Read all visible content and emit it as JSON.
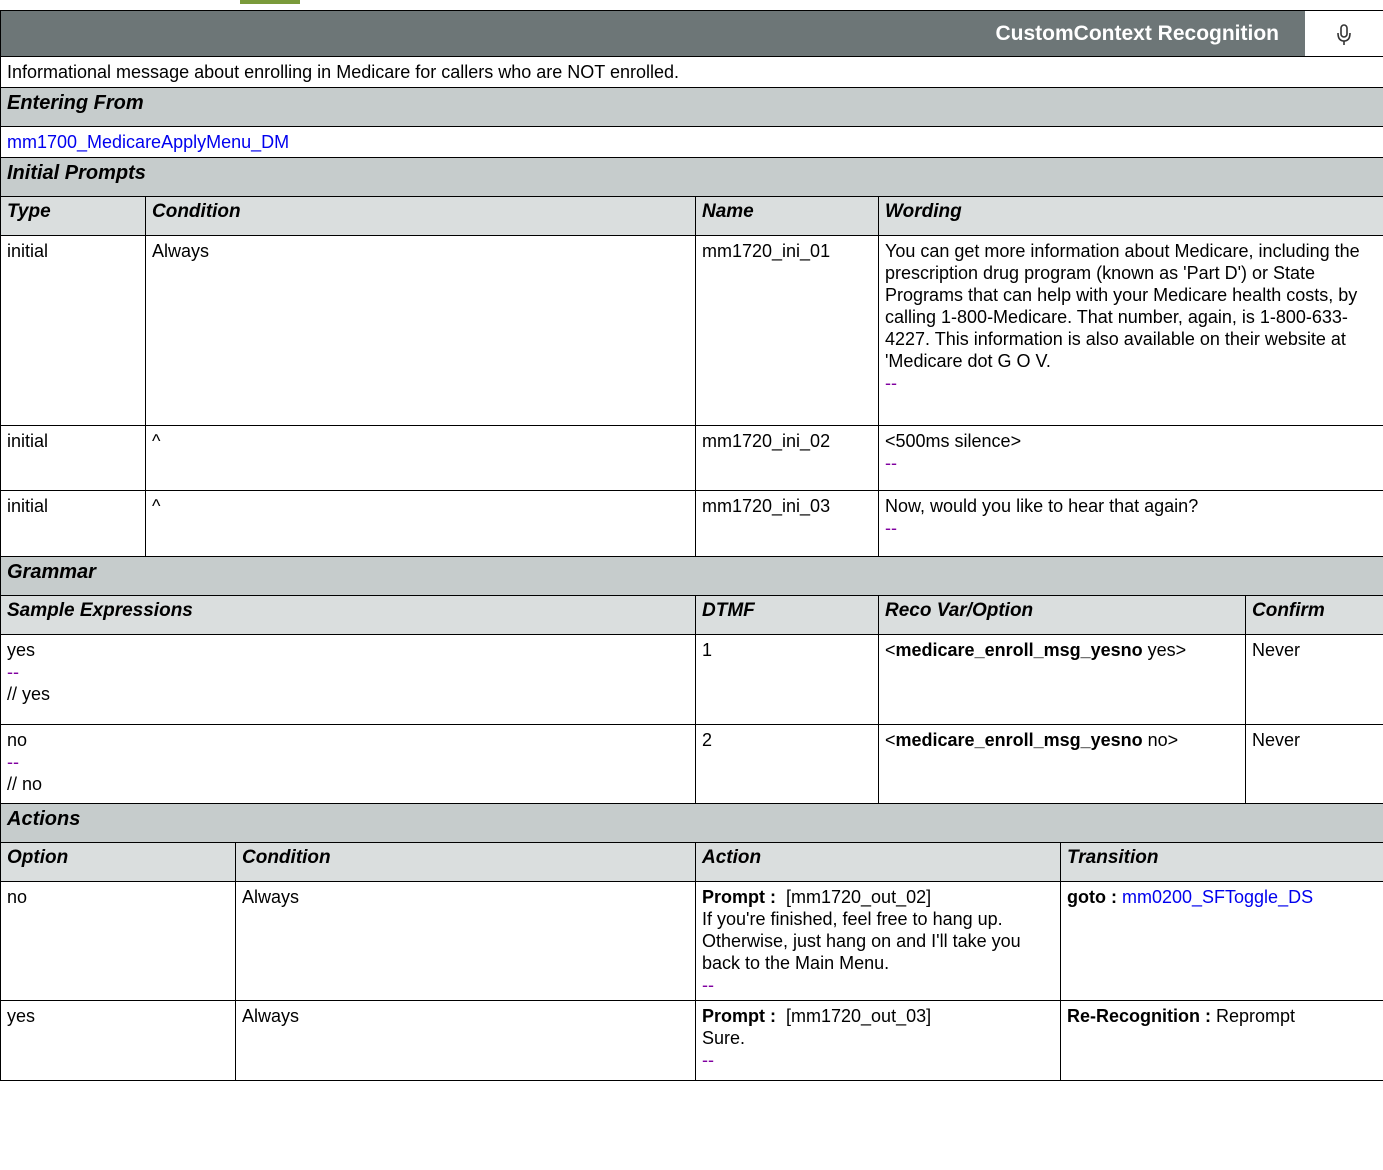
{
  "header": {
    "title": "CustomContext Recognition",
    "mic_icon": "microphone-icon"
  },
  "description": "Informational message about enrolling in Medicare for callers who are NOT enrolled.",
  "entering_from": {
    "label": "Entering From",
    "link": "mm1700_MedicareApplyMenu_DM"
  },
  "initial_prompts": {
    "label": "Initial Prompts",
    "columns": [
      "Type",
      "Condition",
      "Name",
      "Wording"
    ],
    "rows": [
      {
        "type": "initial",
        "condition": "Always",
        "name": "mm1720_ini_01",
        "wording": "You can get more information about Medicare, including the prescription drug program (known as 'Part D') or State Programs that can help with your Medicare health costs, by calling 1-800-Medicare. That number, again, is 1-800-633-4227. This information is also available on their website at 'Medicare dot G O V.",
        "dash": "--"
      },
      {
        "type": "initial",
        "condition": "^",
        "name": "mm1720_ini_02",
        "wording": "<500ms silence>",
        "dash": "--"
      },
      {
        "type": "initial",
        "condition": "^",
        "name": "mm1720_ini_03",
        "wording": "Now, would you like to hear that again?",
        "dash": "--"
      }
    ]
  },
  "grammar": {
    "label": "Grammar",
    "columns": [
      "Sample Expressions",
      "DTMF",
      "Reco Var/Option",
      "Confirm"
    ],
    "rows": [
      {
        "expr": "yes",
        "dash": "--",
        "comment": "// yes",
        "dtmf": "1",
        "var_open": "<",
        "var_name": "medicare_enroll_msg_yesno",
        "var_value": " yes>",
        "confirm": "Never"
      },
      {
        "expr": "no",
        "dash": "--",
        "comment": "// no",
        "dtmf": "2",
        "var_open": "<",
        "var_name": "medicare_enroll_msg_yesno",
        "var_value": " no>",
        "confirm": "Never"
      }
    ]
  },
  "actions": {
    "label": "Actions",
    "columns": [
      "Option",
      "Condition",
      "Action",
      "Transition"
    ],
    "rows": [
      {
        "option": "no",
        "condition": "Always",
        "prompt_label": "Prompt :",
        "prompt_id": "  [mm1720_out_02]",
        "prompt_text": "If you're finished, feel free to hang up. Otherwise, just hang on and I'll take you back to the Main Menu.",
        "dash": "--",
        "transition_label": "goto :",
        "transition_value": " mm0200_SFToggle_DS"
      },
      {
        "option": "yes",
        "condition": "Always",
        "prompt_label": "Prompt :",
        "prompt_id": "  [mm1720_out_03]",
        "prompt_text": "Sure.",
        "dash": "--",
        "transition_label": "Re-Recognition :",
        "transition_value": " Reprompt"
      }
    ]
  }
}
